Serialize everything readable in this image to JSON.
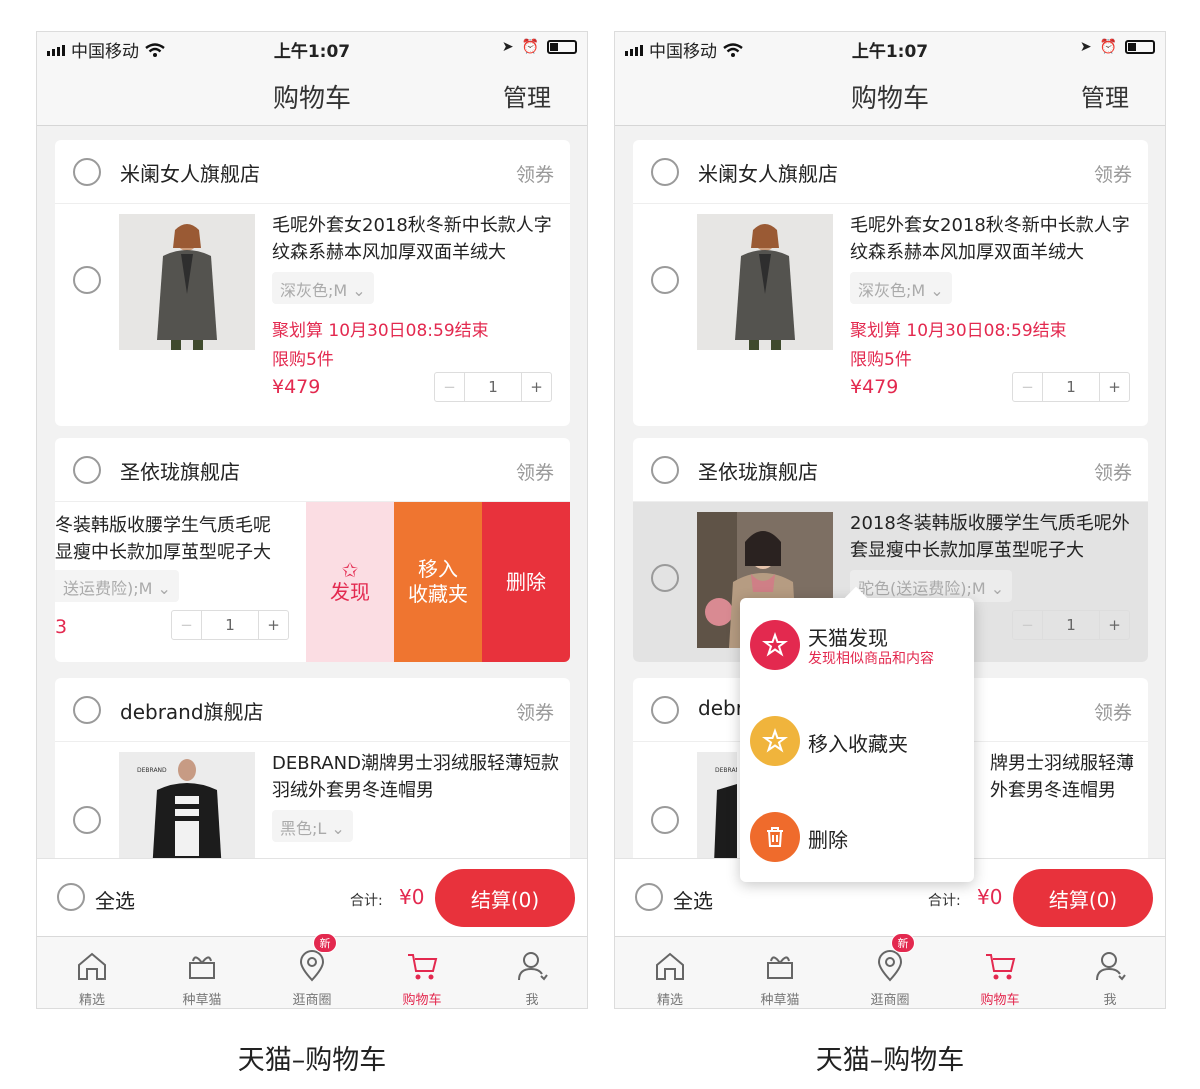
{
  "status_bar": {
    "carrier": "中国移动",
    "time": "上午1:07"
  },
  "nav": {
    "title": "购物车",
    "manage": "管理"
  },
  "shops": [
    {
      "name": "米阑女人旗舰店",
      "coupon": "领券"
    },
    {
      "name": "圣依珑旗舰店",
      "coupon": "领券"
    },
    {
      "name": "debrand旗舰店",
      "coupon": "领券"
    }
  ],
  "items": [
    {
      "title": "毛呢外套女2018秋冬新中长款人字纹森系赫本风加厚双面羊绒大",
      "sku": "深灰色;M",
      "promo": "聚划算 10月30日08:59结束",
      "limit": "限购5件",
      "price": "¥479",
      "qty": "1"
    },
    {
      "title": "2018冬装韩版收腰学生气质毛呢外套显瘦中长款加厚茧型呢子大",
      "sku": "驼色(送运费险);M",
      "qty": "1"
    },
    {
      "title": "DEBRAND潮牌男士羽绒服轻薄短款羽绒外套男冬连帽男",
      "sku": "黑色;L",
      "brand_mark": "DEBRAND"
    }
  ],
  "left_partial": {
    "title_line1": "冬装韩版收腰学生气质毛呢",
    "title_line2": "显瘦中长款加厚茧型呢子大",
    "sku": "送运费险);M",
    "price_fragment": "3",
    "qty": "1"
  },
  "swipe_actions": {
    "discover": "发现",
    "favorite_line1": "移入",
    "favorite_line2": "收藏夹",
    "delete": "删除"
  },
  "popup_menu": {
    "discover_title": "天猫发现",
    "discover_sub": "发现相似商品和内容",
    "favorite": "移入收藏夹",
    "delete": "删除",
    "shop_prefix": "debr",
    "item_title_line1": "牌男士羽绒服轻薄",
    "item_title_line2": "外套男冬连帽男"
  },
  "bottom_bar": {
    "select_all": "全选",
    "total_label": "合计:",
    "total_value": "¥0",
    "checkout": "结算(0)"
  },
  "tabs": [
    {
      "label": "精选",
      "icon": "home-icon"
    },
    {
      "label": "种草猫",
      "icon": "gift-icon"
    },
    {
      "label": "逛商圈",
      "icon": "location-icon",
      "badge": "新"
    },
    {
      "label": "购物车",
      "icon": "cart-icon",
      "active": true
    },
    {
      "label": "我",
      "icon": "user-icon"
    }
  ],
  "captions": {
    "left": "天猫–购物车",
    "right": "天猫–购物车"
  },
  "colors": {
    "accent": "#e3294f",
    "checkout": "#e8323c",
    "swipe_discover_bg": "#fbdde3",
    "swipe_favorite_bg": "#ef7530",
    "swipe_delete_bg": "#e8323c",
    "popup_favorite_icon": "#f0b43c",
    "popup_delete_icon": "#ef6b2c"
  }
}
